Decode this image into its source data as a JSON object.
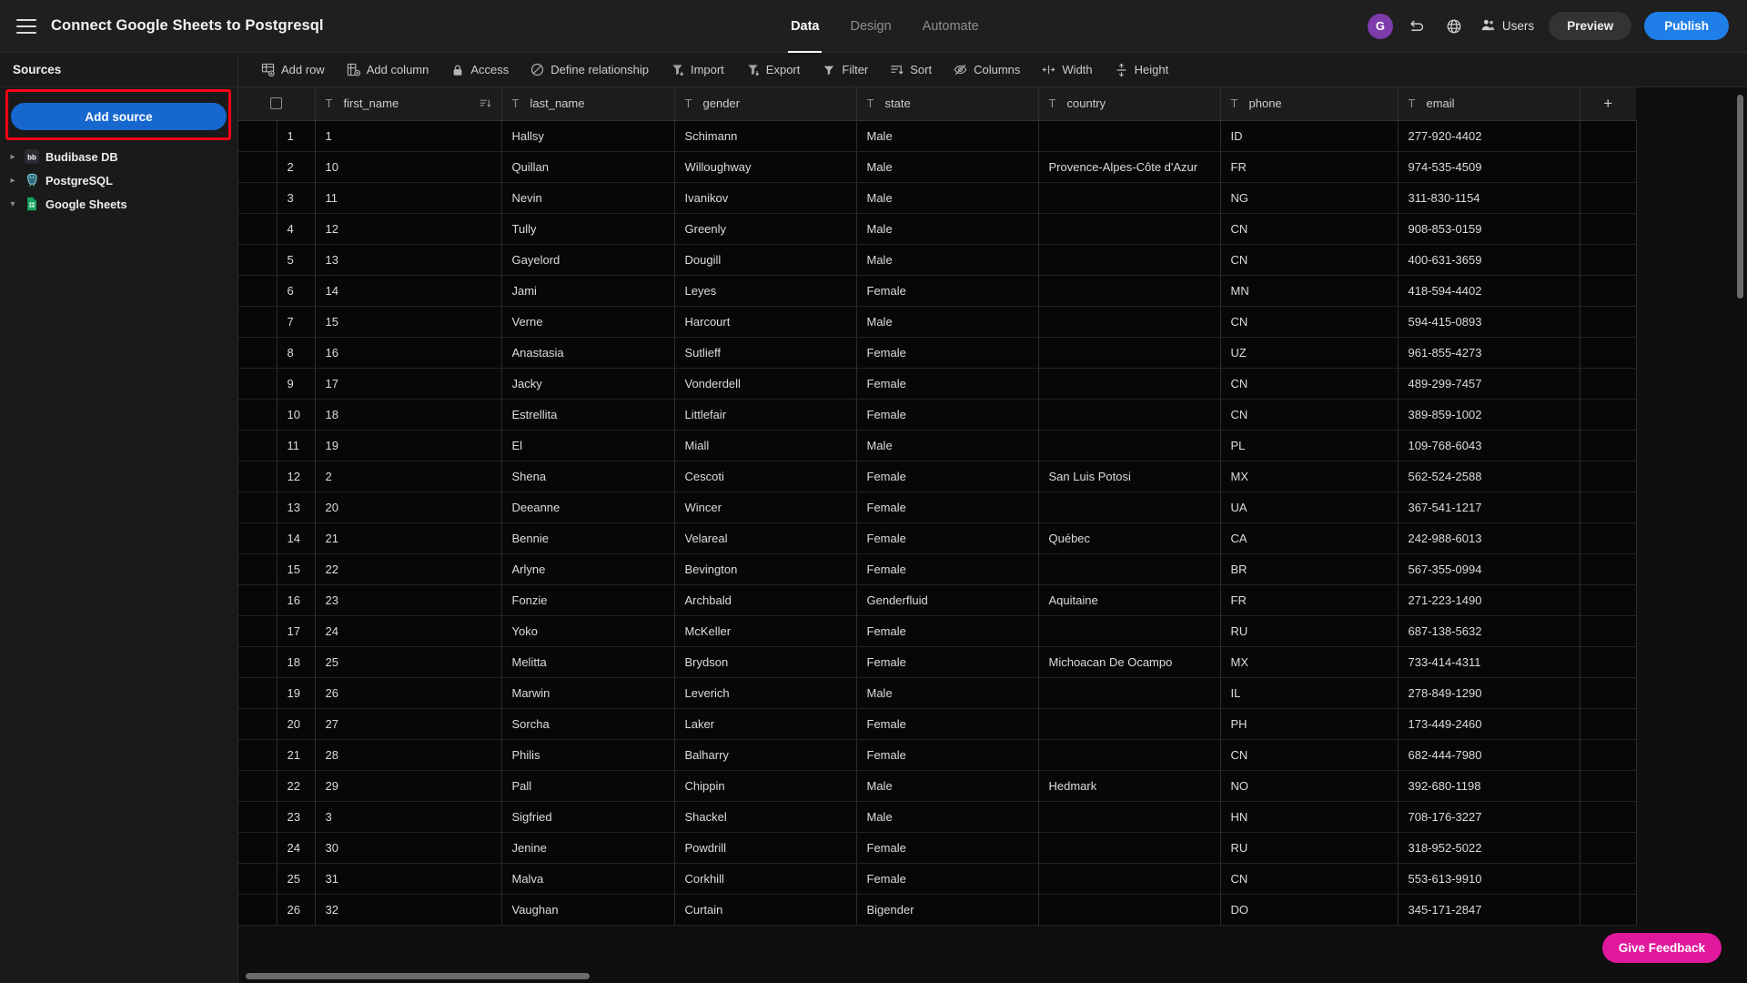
{
  "header": {
    "title": "Connect Google Sheets to Postgresql",
    "menu_icon": "hamburger-icon",
    "tabs": [
      {
        "label": "Data",
        "active": true
      },
      {
        "label": "Design",
        "active": false
      },
      {
        "label": "Automate",
        "active": false
      }
    ],
    "avatar_initial": "G",
    "undo_icon": "undo-icon",
    "globe_icon": "globe-icon",
    "users_label": "Users",
    "preview_label": "Preview",
    "publish_label": "Publish",
    "publish_color": "#1f7ee8",
    "avatar_color": "#7e3bab"
  },
  "sidebar": {
    "title": "Sources",
    "add_source_label": "Add source",
    "add_source_color": "#1668cf",
    "highlight_color": "#ff0016",
    "items": [
      {
        "label": "Budibase DB",
        "icon": "budibase-db-icon",
        "expanded": false
      },
      {
        "label": "PostgreSQL",
        "icon": "postgresql-icon",
        "expanded": false
      },
      {
        "label": "Google Sheets",
        "icon": "google-sheets-icon",
        "expanded": true
      }
    ]
  },
  "toolbar": {
    "items": [
      {
        "label": "Add row",
        "icon": "add-row-icon"
      },
      {
        "label": "Add column",
        "icon": "add-column-icon"
      },
      {
        "label": "Access",
        "icon": "lock-icon"
      },
      {
        "label": "Define relationship",
        "icon": "relationship-icon"
      },
      {
        "label": "Import",
        "icon": "import-icon"
      },
      {
        "label": "Export",
        "icon": "export-icon"
      },
      {
        "label": "Filter",
        "icon": "filter-icon"
      },
      {
        "label": "Sort",
        "icon": "sort-icon"
      },
      {
        "label": "Columns",
        "icon": "eye-off-icon"
      },
      {
        "label": "Width",
        "icon": "width-icon"
      },
      {
        "label": "Height",
        "icon": "height-icon"
      }
    ]
  },
  "table": {
    "add_column_icon": "plus-icon",
    "select_all_icon": "checkbox-icon",
    "columns": [
      {
        "label": "first_name",
        "type_icon": "text-type-icon",
        "sorted": true
      },
      {
        "label": "last_name",
        "type_icon": "text-type-icon",
        "sorted": false
      },
      {
        "label": "gender",
        "type_icon": "text-type-icon",
        "sorted": false
      },
      {
        "label": "state",
        "type_icon": "text-type-icon",
        "sorted": false
      },
      {
        "label": "country",
        "type_icon": "text-type-icon",
        "sorted": false
      },
      {
        "label": "phone",
        "type_icon": "text-type-icon",
        "sorted": false
      },
      {
        "label": "email",
        "type_icon": "text-type-icon",
        "sorted": false
      }
    ],
    "rows": [
      {
        "n": "1",
        "first_name": "1",
        "last_name": "Hallsy",
        "gender": "Schimann",
        "state": "Male",
        "country": "",
        "phone": "ID",
        "email": "277-920-4402"
      },
      {
        "n": "2",
        "first_name": "10",
        "last_name": "Quillan",
        "gender": "Willoughway",
        "state": "Male",
        "country": "Provence-Alpes-Côte d'Azur",
        "phone": "FR",
        "email": "974-535-4509"
      },
      {
        "n": "3",
        "first_name": "11",
        "last_name": "Nevin",
        "gender": "Ivanikov",
        "state": "Male",
        "country": "",
        "phone": "NG",
        "email": "311-830-1154"
      },
      {
        "n": "4",
        "first_name": "12",
        "last_name": "Tully",
        "gender": "Greenly",
        "state": "Male",
        "country": "",
        "phone": "CN",
        "email": "908-853-0159"
      },
      {
        "n": "5",
        "first_name": "13",
        "last_name": "Gayelord",
        "gender": "Dougill",
        "state": "Male",
        "country": "",
        "phone": "CN",
        "email": "400-631-3659"
      },
      {
        "n": "6",
        "first_name": "14",
        "last_name": "Jami",
        "gender": "Leyes",
        "state": "Female",
        "country": "",
        "phone": "MN",
        "email": "418-594-4402"
      },
      {
        "n": "7",
        "first_name": "15",
        "last_name": "Verne",
        "gender": "Harcourt",
        "state": "Male",
        "country": "",
        "phone": "CN",
        "email": "594-415-0893"
      },
      {
        "n": "8",
        "first_name": "16",
        "last_name": "Anastasia",
        "gender": "Sutlieff",
        "state": "Female",
        "country": "",
        "phone": "UZ",
        "email": "961-855-4273"
      },
      {
        "n": "9",
        "first_name": "17",
        "last_name": "Jacky",
        "gender": "Vonderdell",
        "state": "Female",
        "country": "",
        "phone": "CN",
        "email": "489-299-7457"
      },
      {
        "n": "10",
        "first_name": "18",
        "last_name": "Estrellita",
        "gender": "Littlefair",
        "state": "Female",
        "country": "",
        "phone": "CN",
        "email": "389-859-1002"
      },
      {
        "n": "11",
        "first_name": "19",
        "last_name": "El",
        "gender": "Miall",
        "state": "Male",
        "country": "",
        "phone": "PL",
        "email": "109-768-6043"
      },
      {
        "n": "12",
        "first_name": "2",
        "last_name": "Shena",
        "gender": "Cescoti",
        "state": "Female",
        "country": "San Luis Potosi",
        "phone": "MX",
        "email": "562-524-2588"
      },
      {
        "n": "13",
        "first_name": "20",
        "last_name": "Deeanne",
        "gender": "Wincer",
        "state": "Female",
        "country": "",
        "phone": "UA",
        "email": "367-541-1217"
      },
      {
        "n": "14",
        "first_name": "21",
        "last_name": "Bennie",
        "gender": "Velareal",
        "state": "Female",
        "country": "Québec",
        "phone": "CA",
        "email": "242-988-6013"
      },
      {
        "n": "15",
        "first_name": "22",
        "last_name": "Arlyne",
        "gender": "Bevington",
        "state": "Female",
        "country": "",
        "phone": "BR",
        "email": "567-355-0994"
      },
      {
        "n": "16",
        "first_name": "23",
        "last_name": "Fonzie",
        "gender": "Archbald",
        "state": "Genderfluid",
        "country": "Aquitaine",
        "phone": "FR",
        "email": "271-223-1490"
      },
      {
        "n": "17",
        "first_name": "24",
        "last_name": "Yoko",
        "gender": "McKeller",
        "state": "Female",
        "country": "",
        "phone": "RU",
        "email": "687-138-5632"
      },
      {
        "n": "18",
        "first_name": "25",
        "last_name": "Melitta",
        "gender": "Brydson",
        "state": "Female",
        "country": "Michoacan De Ocampo",
        "phone": "MX",
        "email": "733-414-4311"
      },
      {
        "n": "19",
        "first_name": "26",
        "last_name": "Marwin",
        "gender": "Leverich",
        "state": "Male",
        "country": "",
        "phone": "IL",
        "email": "278-849-1290"
      },
      {
        "n": "20",
        "first_name": "27",
        "last_name": "Sorcha",
        "gender": "Laker",
        "state": "Female",
        "country": "",
        "phone": "PH",
        "email": "173-449-2460"
      },
      {
        "n": "21",
        "first_name": "28",
        "last_name": "Philis",
        "gender": "Balharry",
        "state": "Female",
        "country": "",
        "phone": "CN",
        "email": "682-444-7980"
      },
      {
        "n": "22",
        "first_name": "29",
        "last_name": "Pall",
        "gender": "Chippin",
        "state": "Male",
        "country": "Hedmark",
        "phone": "NO",
        "email": "392-680-1198"
      },
      {
        "n": "23",
        "first_name": "3",
        "last_name": "Sigfried",
        "gender": "Shackel",
        "state": "Male",
        "country": "",
        "phone": "HN",
        "email": "708-176-3227"
      },
      {
        "n": "24",
        "first_name": "30",
        "last_name": "Jenine",
        "gender": "Powdrill",
        "state": "Female",
        "country": "",
        "phone": "RU",
        "email": "318-952-5022"
      },
      {
        "n": "25",
        "first_name": "31",
        "last_name": "Malva",
        "gender": "Corkhill",
        "state": "Female",
        "country": "",
        "phone": "CN",
        "email": "553-613-9910"
      },
      {
        "n": "26",
        "first_name": "32",
        "last_name": "Vaughan",
        "gender": "Curtain",
        "state": "Bigender",
        "country": "",
        "phone": "DO",
        "email": "345-171-2847"
      }
    ]
  },
  "feedback": {
    "label": "Give Feedback",
    "color": "#e0189c"
  }
}
